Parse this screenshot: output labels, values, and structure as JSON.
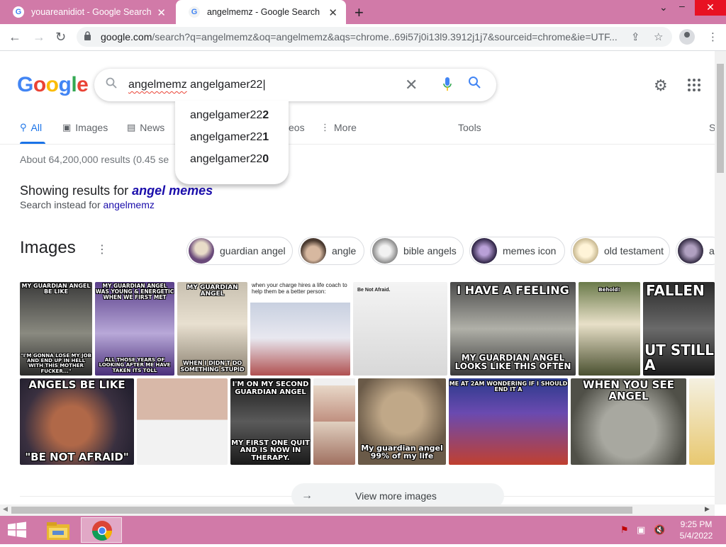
{
  "browser": {
    "tabs": [
      {
        "title": "youareanidiot - Google Search",
        "active": false
      },
      {
        "title": "angelmemz - Google Search",
        "active": true
      }
    ],
    "url": {
      "host": "google.com",
      "path": "/search?q=angelmemz&oq=angelmemz&aqs=chrome..69i57j0i13l9.3912j1j7&sourceid=chrome&ie=UTF..."
    }
  },
  "search": {
    "query_misspelled": "angelmemz",
    "query_rest": " angelgamer22",
    "suggestions": [
      {
        "prefix": "angelgamer22",
        "suffix": "2"
      },
      {
        "prefix": "angelgamer22",
        "suffix": "1"
      },
      {
        "prefix": "angelgamer22",
        "suffix": "0"
      }
    ]
  },
  "logo": {
    "letters": [
      "G",
      "o",
      "o",
      "g",
      "l",
      "e"
    ],
    "colors": [
      "#4285f4",
      "#ea4335",
      "#fbbc05",
      "#4285f4",
      "#34a853",
      "#ea4335"
    ]
  },
  "tabs": {
    "all": "All",
    "images": "Images",
    "news": "News",
    "videos": "eos",
    "more": "More",
    "tools": "Tools",
    "cut": "S"
  },
  "results": {
    "stats": "About 64,200,000 results (0.45 se",
    "showing_prefix": "Showing results for ",
    "showing_term": "angel memes",
    "instead_prefix": "Search instead for ",
    "instead_term": "angelmemz"
  },
  "images": {
    "heading": "Images",
    "chips": [
      "guardian angel",
      "angle",
      "bible angels",
      "memes icon",
      "old testament",
      "a"
    ],
    "captions": {
      "i1_top": "MY GUARDIAN ANGEL BE LIKE",
      "i1_bottom": "\"I'M GONNA LOSE MY JOB AND END UP IN HELL WITH THIS MOTHER FUCKER...\"",
      "i2_top": "MY GUARDIAN ANGEL WAS YOUNG & ENERGETIC WHEN WE FIRST MET",
      "i2_bottom": "ALL THOSE YEARS OF LOOKING AFTER ME HAVE TAKEN ITS TOLL",
      "i3_top": "MY GUARDIAN ANGEL",
      "i3_bottom": "WHEN I DIDN'T DO SOMETHING STUPID",
      "i4_top": "when your charge hires a life coach to help them be a better person:",
      "i5_top": "Be Not Afraid.",
      "i6_top": "I HAVE A FEELING",
      "i6_bottom": "MY GUARDIAN ANGEL LOOKS LIKE THIS OFTEN",
      "i7_top": "Behold!",
      "i8_top": "FALLEN",
      "i8_bottom": "UT STILL A",
      "j1_top": "ANGELS BE LIKE",
      "j1_bottom": "\"BE NOT AFRAID\"",
      "j3_top": "I'M ON MY SECOND GUARDIAN ANGEL",
      "j3_bottom": "MY FIRST ONE QUIT AND IS NOW IN THERAPY.",
      "j5_bottom": "My guardian angel 99% of my life",
      "j6_top": "ME AT 2AM WONDERING IF I SHOULD END IT A",
      "j7_top": "WHEN YOU SEE ANGEL"
    },
    "view_more": "View more images"
  },
  "taskbar": {
    "time": "9:25 PM",
    "date": "5/4/2022"
  }
}
